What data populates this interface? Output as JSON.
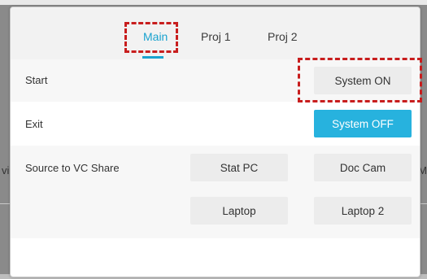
{
  "background": {
    "left_text": "vi",
    "right_text": "M"
  },
  "tabs": [
    {
      "label": "Main",
      "active": true
    },
    {
      "label": "Proj 1",
      "active": false
    },
    {
      "label": "Proj 2",
      "active": false
    }
  ],
  "rows": {
    "start": {
      "label": "Start",
      "button": "System ON"
    },
    "exit": {
      "label": "Exit",
      "button": "System OFF"
    },
    "source": {
      "label": "Source to VC Share",
      "buttons": [
        "Stat PC",
        "Doc Cam",
        "Laptop",
        "Laptop 2"
      ]
    }
  },
  "colors": {
    "accent": "#27b2de",
    "tab_active": "#1aa3cf",
    "annotation": "#c81e1e"
  }
}
